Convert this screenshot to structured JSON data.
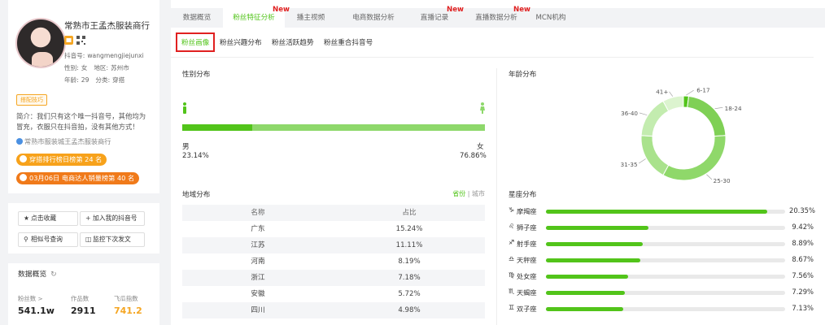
{
  "profile": {
    "name": "常熟市王孟杰服装商行",
    "account_label": "抖音号:",
    "account": "wangmengjiejunxi",
    "gender_label": "性别:",
    "gender": "女",
    "region_label": "地区:",
    "region": "苏州市",
    "age_label": "年龄:",
    "age": "29",
    "category_label": "分类:",
    "category": "穿搭",
    "tag": "搭配技巧",
    "bio_line1": "简介：我们只有这个唯一抖音号，其他均为",
    "bio_line2": "冒充，衣服只在抖音拍，没有其他方式！",
    "shop": "常熟市服装城王孟杰服装商行",
    "rank1_label": "穿搭排行榜日榜第",
    "rank1_value": "24",
    "rank1_unit": "名",
    "rank2_label": "03月06日 电商达人销量榜第",
    "rank2_value": "40",
    "rank2_unit": "名"
  },
  "actions": {
    "collect": "点击收藏",
    "add": "加入我的抖音号",
    "similar": "相似号查询",
    "monitor": "监控下次发文"
  },
  "overview": {
    "title": "数据概览",
    "fans_label": "粉丝数 >",
    "fans": "541.1w",
    "works_label": "作品数",
    "works": "2911",
    "index_label": "飞瓜指数",
    "index": "741.2"
  },
  "tabs": [
    {
      "label": "数据概览",
      "new": ""
    },
    {
      "label": "粉丝特征分析",
      "new": "New"
    },
    {
      "label": "播主视频",
      "new": ""
    },
    {
      "label": "电商数据分析",
      "new": ""
    },
    {
      "label": "直播记录",
      "new": "New"
    },
    {
      "label": "直播数据分析",
      "new": "New"
    },
    {
      "label": "MCN机构",
      "new": ""
    }
  ],
  "subtabs": [
    "粉丝画像",
    "粉丝兴趣分布",
    "粉丝活跃趋势",
    "粉丝重合抖音号"
  ],
  "gender": {
    "title": "性别分布",
    "male_label": "男",
    "male_pct": "23.14%",
    "female_label": "女",
    "female_pct": "76.86%",
    "male_value": 23.14,
    "male_color": "#52c41a",
    "female_color": "#8ed86b"
  },
  "region": {
    "title": "地域分布",
    "toggle_province": "省份",
    "toggle_sep": "|",
    "toggle_city": "城市",
    "col_name": "名称",
    "col_pct": "占比",
    "rows": [
      {
        "name": "广东",
        "pct": "15.24%"
      },
      {
        "name": "江苏",
        "pct": "11.11%"
      },
      {
        "name": "河南",
        "pct": "8.19%"
      },
      {
        "name": "浙江",
        "pct": "7.18%"
      },
      {
        "name": "安徽",
        "pct": "5.72%"
      },
      {
        "name": "四川",
        "pct": "4.98%"
      }
    ]
  },
  "age": {
    "title": "年龄分布",
    "segments": [
      {
        "label": "6-17",
        "value": 2,
        "color": "#52c41a"
      },
      {
        "label": "18-24",
        "value": 22,
        "color": "#7fd055"
      },
      {
        "label": "25-30",
        "value": 34,
        "color": "#8fd86a"
      },
      {
        "label": "31-35",
        "value": 18,
        "color": "#a9e28c"
      },
      {
        "label": "36-40",
        "value": 16,
        "color": "#c3ecaf"
      },
      {
        "label": "41+",
        "value": 8,
        "color": "#dcf4cf"
      }
    ]
  },
  "zodiac": {
    "title": "星座分布",
    "max": 22,
    "items": [
      {
        "icon": "♑",
        "name": "摩羯座",
        "value": 20.35,
        "pct": "20.35%"
      },
      {
        "icon": "♌",
        "name": "狮子座",
        "value": 9.42,
        "pct": "9.42%"
      },
      {
        "icon": "♐",
        "name": "射手座",
        "value": 8.89,
        "pct": "8.89%"
      },
      {
        "icon": "♎",
        "name": "天秤座",
        "value": 8.67,
        "pct": "8.67%"
      },
      {
        "icon": "♍",
        "name": "处女座",
        "value": 7.56,
        "pct": "7.56%"
      },
      {
        "icon": "♏",
        "name": "天蝎座",
        "value": 7.29,
        "pct": "7.29%"
      },
      {
        "icon": "♊",
        "name": "双子座",
        "value": 7.13,
        "pct": "7.13%"
      }
    ]
  }
}
